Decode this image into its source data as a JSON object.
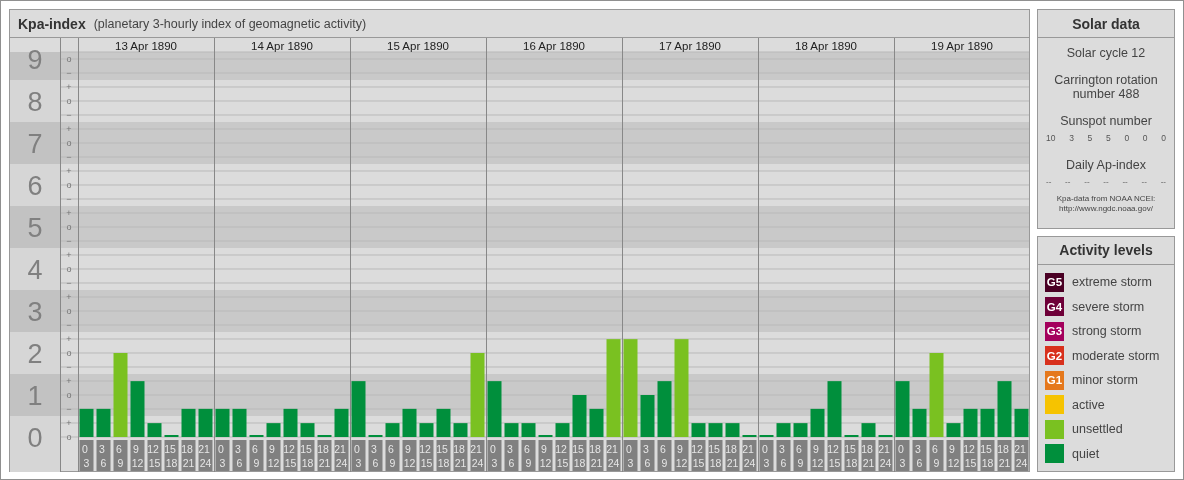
{
  "kp_panel": {
    "title": "Kpa-index",
    "subtitle": "(planetary 3-hourly index of geomagnetic activity)",
    "days": [
      {
        "date": "13 Apr 1890"
      },
      {
        "date": "14 Apr 1890"
      },
      {
        "date": "15 Apr 1890"
      },
      {
        "date": "16 Apr 1890"
      },
      {
        "date": "17 Apr 1890"
      },
      {
        "date": "18 Apr 1890"
      },
      {
        "date": "19 Apr 1890"
      }
    ],
    "scale_marks": [
      [
        "o",
        "−"
      ],
      [
        "+",
        "o",
        "−"
      ],
      [
        "+",
        "o",
        "−"
      ],
      [
        "+",
        "o",
        "−"
      ],
      [
        "+",
        "o",
        "−"
      ],
      [
        "+",
        "o",
        "−"
      ],
      [
        "+",
        "o",
        "−"
      ],
      [
        "+",
        "o",
        "−"
      ],
      [
        "+",
        "o",
        "−"
      ],
      [
        "+",
        "o"
      ]
    ],
    "chart_data": {
      "type": "bar",
      "stacked": true,
      "grid": true,
      "ylim": [
        0,
        9
      ],
      "yticks": [
        0,
        1,
        2,
        3,
        4,
        5,
        6,
        7,
        8,
        9
      ],
      "categories": [
        "0 3",
        "3 6",
        "6 9",
        "9 12",
        "12 15",
        "15 18",
        "18 21",
        "21 24",
        "0 3",
        "3 6",
        "6 9",
        "9 12",
        "12 15",
        "15 18",
        "18 21",
        "21 24",
        "0 3",
        "3 6",
        "6 9",
        "9 12",
        "12 15",
        "15 18",
        "18 21",
        "21 24",
        "0 3",
        "3 6",
        "6 9",
        "9 12",
        "12 15",
        "15 18",
        "18 21",
        "21 24",
        "0 3",
        "3 6",
        "6 9",
        "9 12",
        "12 15",
        "15 18",
        "18 21",
        "21 24",
        "0 3",
        "3 6",
        "6 9",
        "9 12",
        "12 15",
        "15 18",
        "18 21",
        "21 24",
        "0 3",
        "3 6",
        "6 9",
        "9 12",
        "12 15",
        "15 18",
        "18 21",
        "21 24"
      ],
      "series": [
        {
          "name": "quiet",
          "color": "#008f3c",
          "values": [
            0.67,
            0.67,
            null,
            1.33,
            0.33,
            0,
            0.67,
            0.67,
            0.67,
            0.67,
            0,
            0.33,
            0.67,
            0.33,
            0,
            0.67,
            1.33,
            0,
            0.33,
            0.67,
            0.33,
            0.67,
            0.33,
            null,
            1.33,
            0.33,
            0.33,
            0,
            0.33,
            1,
            0.67,
            null,
            null,
            1,
            1.33,
            null,
            0.33,
            0.33,
            0.33,
            0,
            0,
            0.33,
            0.33,
            0.67,
            1.33,
            0,
            0.33,
            0,
            1.33,
            0.67,
            null,
            0.33,
            0.67,
            0.67,
            1.33,
            0.67
          ]
        },
        {
          "name": "unsettled",
          "color": "#7ac121",
          "values": [
            null,
            null,
            2,
            null,
            null,
            null,
            null,
            null,
            null,
            null,
            null,
            null,
            null,
            null,
            null,
            null,
            null,
            null,
            null,
            null,
            null,
            null,
            null,
            2,
            null,
            null,
            null,
            null,
            null,
            null,
            null,
            2.33,
            2.33,
            null,
            null,
            2.33,
            null,
            null,
            null,
            null,
            null,
            null,
            null,
            null,
            null,
            null,
            null,
            null,
            null,
            null,
            2,
            null,
            null,
            null,
            null,
            null
          ]
        }
      ]
    }
  },
  "solar_data": {
    "title": "Solar data",
    "solar_cycle": "Solar cycle 12",
    "carrington": "Carrington rotation number 488",
    "sunspot_label": "Sunspot number",
    "sunspot_values": [
      "10",
      "3",
      "5",
      "5",
      "0",
      "0",
      "0"
    ],
    "ap_label": "Daily Ap-index",
    "ap_values": [
      "--",
      "--",
      "--",
      "--",
      "--",
      "--",
      "--"
    ],
    "source": "Kpa-data from NOAA NCEI:",
    "source_link": "http://www.ngdc.noaa.gov/"
  },
  "legend": {
    "title": "Activity levels",
    "items": [
      {
        "badge": "G5",
        "label": "extreme storm",
        "color": "#4a0024"
      },
      {
        "badge": "G4",
        "label": "severe storm",
        "color": "#6e0038"
      },
      {
        "badge": "G3",
        "label": "strong storm",
        "color": "#a4005c"
      },
      {
        "badge": "G2",
        "label": "moderate storm",
        "color": "#d8301c"
      },
      {
        "badge": "G1",
        "label": "minor storm",
        "color": "#e5781c"
      },
      {
        "label": "active",
        "color": "#f6c300"
      }
    ]
  }
}
